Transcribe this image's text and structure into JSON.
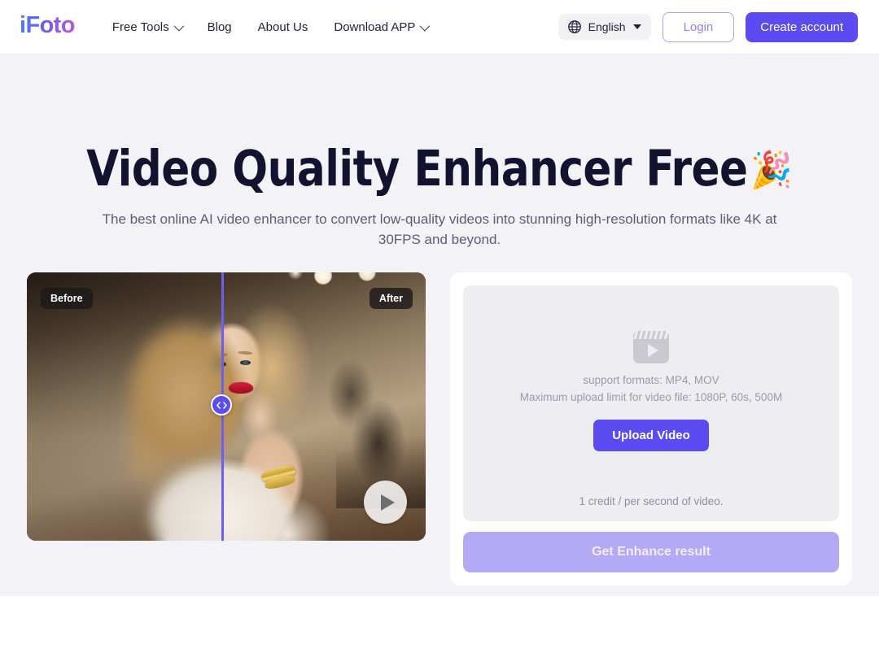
{
  "brand": {
    "logo_text": "iFoto",
    "accent_purple": "#5b4bf0",
    "accent_light_purple": "#b4a9f5",
    "title_color": "#11132f",
    "hero_bg": "#f3f3f7"
  },
  "header": {
    "nav": [
      {
        "label": "Free Tools",
        "has_dropdown": true
      },
      {
        "label": "Blog",
        "has_dropdown": false
      },
      {
        "label": "About Us",
        "has_dropdown": false
      },
      {
        "label": "Download APP",
        "has_dropdown": true
      }
    ],
    "language": {
      "icon": "globe-icon",
      "label": "English"
    },
    "login_label": "Login",
    "create_account_label": "Create account"
  },
  "hero": {
    "title": "Video Quality Enhancer Free",
    "title_emoji": "🎉",
    "subtitle": "The best online AI video enhancer to convert low-quality videos into stunning high-resolution formats like 4K at 30FPS and beyond."
  },
  "compare": {
    "before_label": "Before",
    "after_label": "After",
    "handle_icon": "left-right-arrows-icon",
    "play_icon": "play-icon",
    "divider_position_percent": 49,
    "divider_color": "#6d5df2"
  },
  "upload": {
    "icon": "video-clapperboard-icon",
    "formats_text": "support formats: MP4, MOV",
    "limit_text": "Maximum upload limit for video file: 1080P, 60s, 500M",
    "upload_button_label": "Upload Video",
    "credit_text": "1 credit / per second of video.",
    "enhance_button_label": "Get Enhance result",
    "enhance_button_enabled": false
  }
}
